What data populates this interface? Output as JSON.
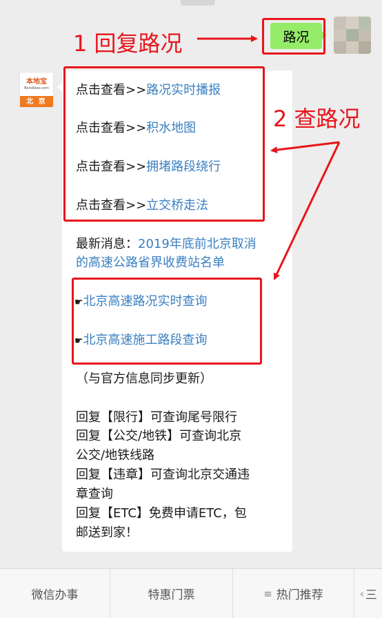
{
  "user_message": {
    "text": "路况"
  },
  "bot": {
    "avatar": {
      "logo_text": "本地宝",
      "logo_subtext": "Bendibao.com",
      "city": "北 京"
    },
    "links": [
      {
        "prefix": "点击查看>>",
        "link": "路况实时播报"
      },
      {
        "prefix": "点击查看>>",
        "link": "积水地图"
      },
      {
        "prefix": "点击查看>>",
        "link": "拥堵路段绕行"
      },
      {
        "prefix": "点击查看>>",
        "link": "立交桥走法"
      }
    ],
    "news": {
      "label": "最新消息：",
      "link_line1": "2019年底前北京取消",
      "link_line2": "的高速公路省界收费站名单"
    },
    "highway_links": [
      {
        "icon": "☛",
        "link": "北京高速路况实时查询"
      },
      {
        "icon": "☛",
        "link": "北京高速施工路段查询"
      }
    ],
    "sync_note": "（与官方信息同步更新）",
    "reply_lines": [
      "回复【限行】可查询尾号限行",
      "回复【公交/地铁】可查询北京",
      "公交/地铁线路",
      "回复【违章】可查询北京交通违",
      "章查询",
      "回复【ETC】免费申请ETC，包",
      "邮送到家！"
    ]
  },
  "annotations": {
    "label1": "1 回复路况",
    "label2": "2 查路况",
    "color": "#e8141b"
  },
  "bottom_menu": [
    {
      "label": "微信办事"
    },
    {
      "label": "特惠门票"
    },
    {
      "label": "热门推荐",
      "icon": "≡"
    },
    {
      "label": "三",
      "icon": "‹"
    }
  ]
}
